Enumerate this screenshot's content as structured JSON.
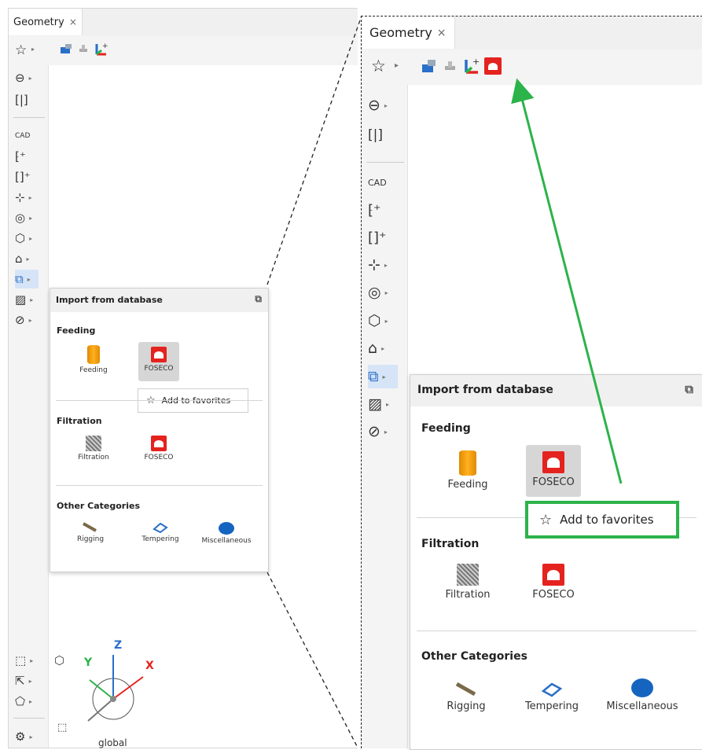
{
  "window": {
    "tab_title": "Geometry",
    "tab_close": "×"
  },
  "popup": {
    "title": "Import from database",
    "categories": [
      {
        "label": "Feeding",
        "items": [
          {
            "label": "Feeding",
            "icon": "feeding-icon"
          },
          {
            "label": "FOSECO",
            "icon": "foseco-icon"
          }
        ]
      },
      {
        "label": "Filtration",
        "items": [
          {
            "label": "Filtration",
            "icon": "filtration-icon"
          },
          {
            "label": "FOSECO",
            "icon": "foseco-icon"
          }
        ]
      },
      {
        "label": "Other Categories",
        "items": [
          {
            "label": "Rigging",
            "icon": "rigging-icon"
          },
          {
            "label": "Tempering",
            "icon": "tempering-icon"
          },
          {
            "label": "Miscellaneous",
            "icon": "miscellaneous-icon"
          }
        ]
      }
    ]
  },
  "context_menu": {
    "add_to_favorites": "Add to favorites"
  },
  "gizmo": {
    "z": "Z",
    "y": "Y",
    "x": "X",
    "label": "global"
  },
  "colors": {
    "accent_green": "#2cb34a",
    "foseco_red": "#e4231f",
    "feeding_orange": "#f5a00b"
  }
}
